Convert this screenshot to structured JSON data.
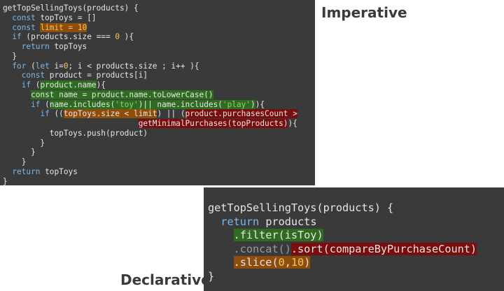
{
  "labels": {
    "imperative": "Imperative",
    "declarative": "Declarative"
  },
  "imperative_code": [
    [
      {
        "t": "getTopSellingToys(products) {",
        "c": "t"
      }
    ],
    [
      {
        "t": "  ",
        "c": "t"
      },
      {
        "t": "const",
        "c": "k"
      },
      {
        "t": " topToys = []",
        "c": "t"
      }
    ],
    [
      {
        "t": "  ",
        "c": "t"
      },
      {
        "t": "const",
        "c": "k"
      },
      {
        "t": " ",
        "c": "t"
      },
      {
        "t": "limit = 10",
        "c": "n",
        "h": "o"
      }
    ],
    [
      {
        "t": "  ",
        "c": "t"
      },
      {
        "t": "if",
        "c": "k"
      },
      {
        "t": " (products.size === ",
        "c": "t"
      },
      {
        "t": "0",
        "c": "n"
      },
      {
        "t": " ){",
        "c": "t"
      }
    ],
    [
      {
        "t": "    ",
        "c": "t"
      },
      {
        "t": "return",
        "c": "k"
      },
      {
        "t": " topToys",
        "c": "t"
      }
    ],
    [
      {
        "t": "  }",
        "c": "t"
      }
    ],
    [
      {
        "t": "  ",
        "c": "t"
      },
      {
        "t": "for",
        "c": "k"
      },
      {
        "t": " (",
        "c": "t"
      },
      {
        "t": "let",
        "c": "k"
      },
      {
        "t": " i=",
        "c": "t"
      },
      {
        "t": "0",
        "c": "n"
      },
      {
        "t": "; i < products.size ; i++ ){",
        "c": "t"
      }
    ],
    [
      {
        "t": "    ",
        "c": "t"
      },
      {
        "t": "const",
        "c": "k"
      },
      {
        "t": " product = products[i]",
        "c": "t"
      }
    ],
    [
      {
        "t": "    ",
        "c": "t"
      },
      {
        "t": "if",
        "c": "k"
      },
      {
        "t": " (",
        "c": "t"
      },
      {
        "t": "product.name",
        "c": "t",
        "h": "g"
      },
      {
        "t": "){",
        "c": "t"
      }
    ],
    [
      {
        "t": "      ",
        "c": "t"
      },
      {
        "t": "const name = product.name.toLowerCase()",
        "c": "t",
        "h": "g"
      }
    ],
    [
      {
        "t": "      ",
        "c": "t"
      },
      {
        "t": "if",
        "c": "k"
      },
      {
        "t": " (",
        "c": "t"
      },
      {
        "t": "name.includes(",
        "c": "t",
        "h": "g"
      },
      {
        "t": "'toy'",
        "c": "s",
        "h": "g"
      },
      {
        "t": ")|| name.includes(",
        "c": "t",
        "h": "g"
      },
      {
        "t": "'play'",
        "c": "s",
        "h": "g"
      },
      {
        "t": ")",
        "c": "t",
        "h": "g"
      },
      {
        "t": "){",
        "c": "t"
      }
    ],
    [
      {
        "t": "        ",
        "c": "t"
      },
      {
        "t": "if",
        "c": "k"
      },
      {
        "t": " ((",
        "c": "t"
      },
      {
        "t": "topToys.size < limit",
        "c": "t",
        "h": "o"
      },
      {
        "t": ") || (",
        "c": "t"
      },
      {
        "t": "product.purchasesCount >",
        "c": "t",
        "h": "r"
      }
    ],
    [
      {
        "t": "                             ",
        "c": "t"
      },
      {
        "t": "getMinimalPurchases(topProducts)",
        "c": "t",
        "h": "r"
      },
      {
        "t": "){",
        "c": "t"
      }
    ],
    [
      {
        "t": "          topToys.push(product)",
        "c": "t"
      }
    ],
    [
      {
        "t": "        }",
        "c": "t"
      }
    ],
    [
      {
        "t": "      }",
        "c": "t"
      }
    ],
    [
      {
        "t": "    }",
        "c": "t"
      }
    ],
    [
      {
        "t": "  ",
        "c": "t"
      },
      {
        "t": "return",
        "c": "k"
      },
      {
        "t": " topToys",
        "c": "t"
      }
    ],
    [
      {
        "t": "}",
        "c": "t"
      }
    ]
  ],
  "declarative_code": [
    [
      {
        "t": "getTopSellingToys(products) {",
        "c": "t"
      }
    ],
    [
      {
        "t": "  ",
        "c": "t"
      },
      {
        "t": "return",
        "c": "k"
      },
      {
        "t": " products",
        "c": "t"
      }
    ],
    [
      {
        "t": "    ",
        "c": "t"
      },
      {
        "t": ".filter(isToy)",
        "c": "t",
        "h": "g"
      }
    ],
    [
      {
        "t": "    ",
        "c": "t"
      },
      {
        "t": ".concat()",
        "c": "o"
      },
      {
        "t": ".sort(compareByPurchaseCount)",
        "c": "t",
        "h": "r"
      }
    ],
    [
      {
        "t": "    ",
        "c": "t"
      },
      {
        "t": ".slice(",
        "c": "t",
        "h": "o"
      },
      {
        "t": "0",
        "c": "n",
        "h": "o"
      },
      {
        "t": ",",
        "c": "t",
        "h": "o"
      },
      {
        "t": "10",
        "c": "n",
        "h": "o"
      },
      {
        "t": ")",
        "c": "t",
        "h": "o"
      }
    ],
    [
      {
        "t": "}",
        "c": "t"
      }
    ]
  ]
}
